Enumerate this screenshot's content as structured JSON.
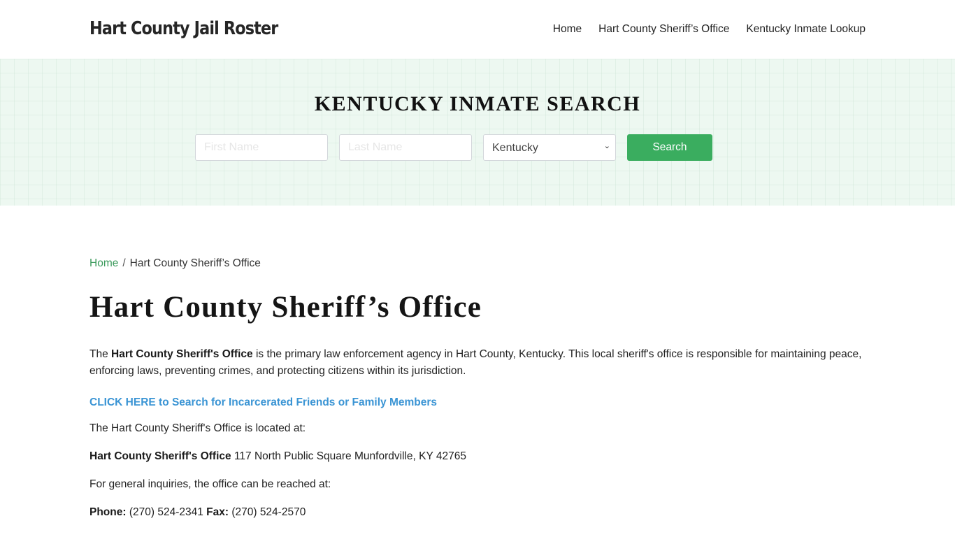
{
  "header": {
    "brand": "Hart County Jail Roster",
    "nav": [
      {
        "label": "Home"
      },
      {
        "label": "Hart County Sheriff’s Office"
      },
      {
        "label": "Kentucky Inmate Lookup"
      }
    ]
  },
  "hero": {
    "title": "KENTUCKY INMATE SEARCH",
    "first_name_placeholder": "First Name",
    "first_name_value": "",
    "last_name_placeholder": "Last Name",
    "last_name_value": "",
    "state_selected": "Kentucky",
    "search_label": "Search",
    "accent_color": "#3aad5f"
  },
  "breadcrumb": {
    "home": "Home",
    "separator": "/",
    "current": "Hart County Sheriff’s Office"
  },
  "main": {
    "title": "Hart County Sheriff’s Office",
    "intro_prefix": "The ",
    "intro_bold": "Hart County Sheriff's Office",
    "intro_rest": " is the primary law enforcement agency in Hart County, Kentucky. This local sheriff's office is responsible for maintaining peace, enforcing laws, preventing crimes, and protecting citizens within its jurisdiction.",
    "cta_link": "CLICK HERE to Search for Incarcerated Friends or Family Members",
    "located_text": "The Hart County Sheriff's Office is located at:",
    "address_bold": "Hart County Sheriff's Office",
    "address": " 117 North Public Square Munfordville, KY 42765",
    "inquiries_text": "For general inquiries, the office can be reached at:",
    "phone_label": "Phone:",
    "phone": " (270) 524-2341 ",
    "fax_label": "Fax:",
    "fax": " (270) 524-2570"
  }
}
